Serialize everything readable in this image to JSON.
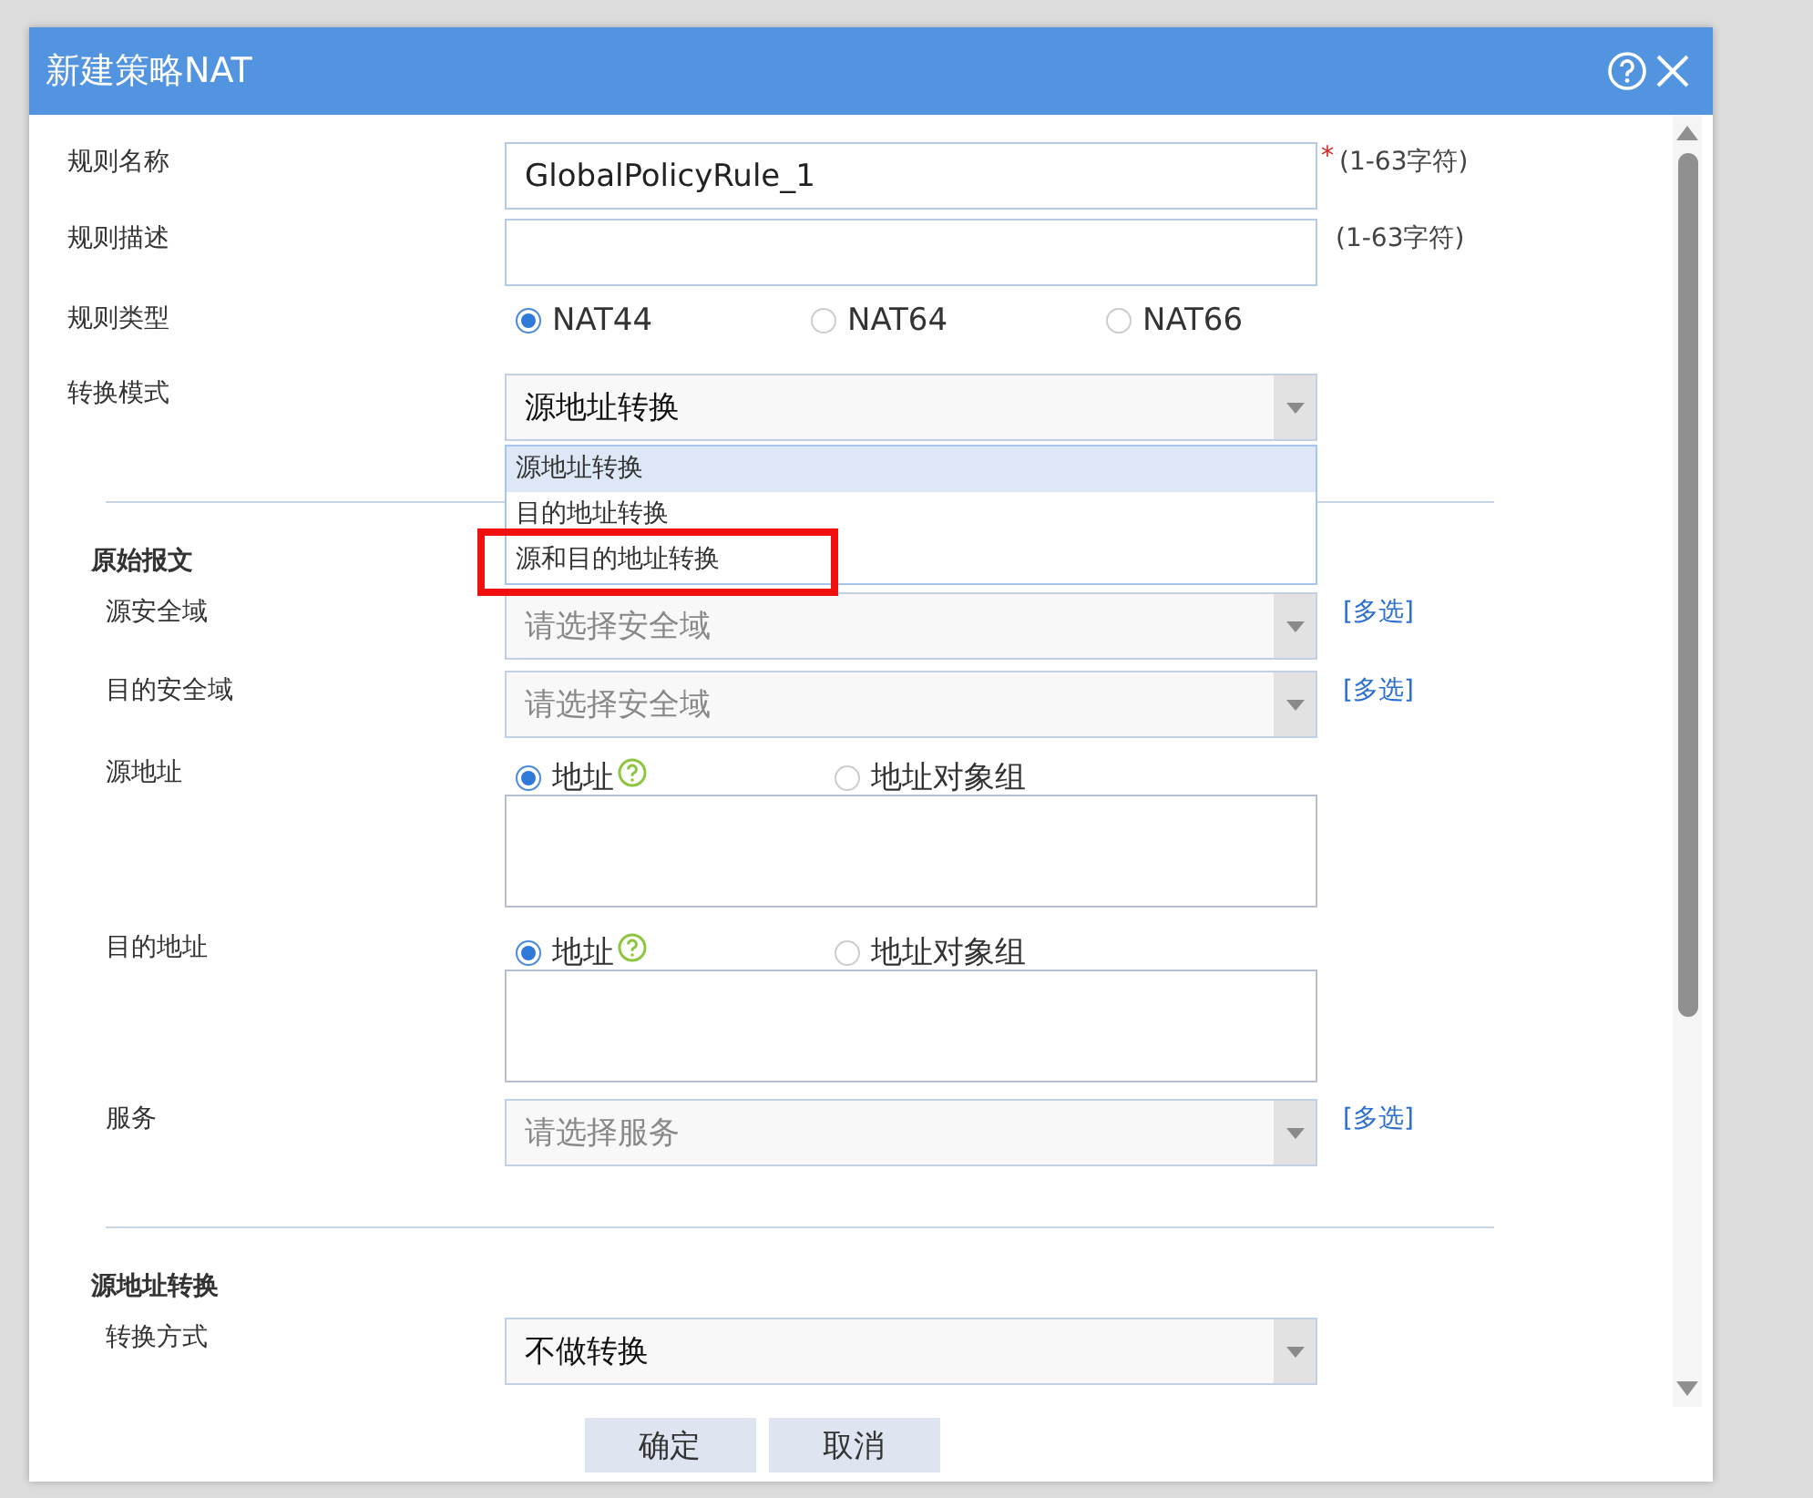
{
  "dialog": {
    "title": "新建策略NAT"
  },
  "sections": [
    {
      "rows": [
        {
          "kind": "text",
          "label": "规则名称",
          "value": "GlobalPolicyRule_1",
          "required_mark": "*",
          "hint": "(1-63字符)"
        },
        {
          "kind": "text",
          "label": "规则描述",
          "value": "",
          "hint": "(1-63字符)"
        },
        {
          "kind": "radio",
          "label": "规则类型",
          "options": [
            {
              "label": "NAT44",
              "selected": true
            },
            {
              "label": "NAT64",
              "selected": false
            },
            {
              "label": "NAT66",
              "selected": false
            }
          ]
        },
        {
          "kind": "select",
          "label": "转换模式",
          "value": "源地址转换",
          "expanded": true,
          "options": [
            {
              "label": "源地址转换",
              "selected": true,
              "highlighted": false
            },
            {
              "label": "目的地址转换",
              "selected": false,
              "highlighted": false
            },
            {
              "label": "源和目的地址转换",
              "selected": false,
              "highlighted": true
            }
          ]
        }
      ]
    },
    {
      "heading": "原始报文",
      "rows": [
        {
          "kind": "select",
          "label": "源安全域",
          "placeholder": "请选择安全域",
          "link": "[多选]"
        },
        {
          "kind": "select",
          "label": "目的安全域",
          "placeholder": "请选择安全域",
          "link": "[多选]"
        },
        {
          "kind": "radio",
          "label": "源地址",
          "options": [
            {
              "label": "地址",
              "selected": true,
              "help": true
            },
            {
              "label": "地址对象组",
              "selected": false
            }
          ]
        },
        {
          "kind": "textarea"
        },
        {
          "kind": "radio",
          "label": "目的地址",
          "options": [
            {
              "label": "地址",
              "selected": true,
              "help": true
            },
            {
              "label": "地址对象组",
              "selected": false
            }
          ]
        },
        {
          "kind": "textarea"
        },
        {
          "kind": "select",
          "label": "服务",
          "placeholder": "请选择服务",
          "link": "[多选]"
        }
      ]
    },
    {
      "heading": "源地址转换",
      "rows": [
        {
          "kind": "select",
          "label": "转换方式",
          "value": "不做转换"
        }
      ]
    }
  ],
  "buttons": [
    "确定",
    "取消"
  ]
}
